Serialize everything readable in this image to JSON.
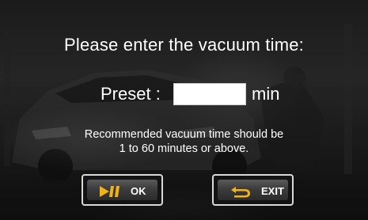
{
  "dialog": {
    "title": "Please enter the vacuum time:",
    "preset_label": "Preset :",
    "preset_value": "",
    "preset_unit": "min",
    "hint_line1": "Recommended vacuum time should be",
    "hint_line2": "1 to 60 minutes or above."
  },
  "buttons": {
    "ok_label": "OK",
    "ok_icon": "play-pause-icon",
    "exit_label": "EXIT",
    "exit_icon": "return-arrow-icon"
  },
  "colors": {
    "text": "#ffffff",
    "icon_accent": "#f2b21c",
    "button_border": "#d9d9d9"
  }
}
